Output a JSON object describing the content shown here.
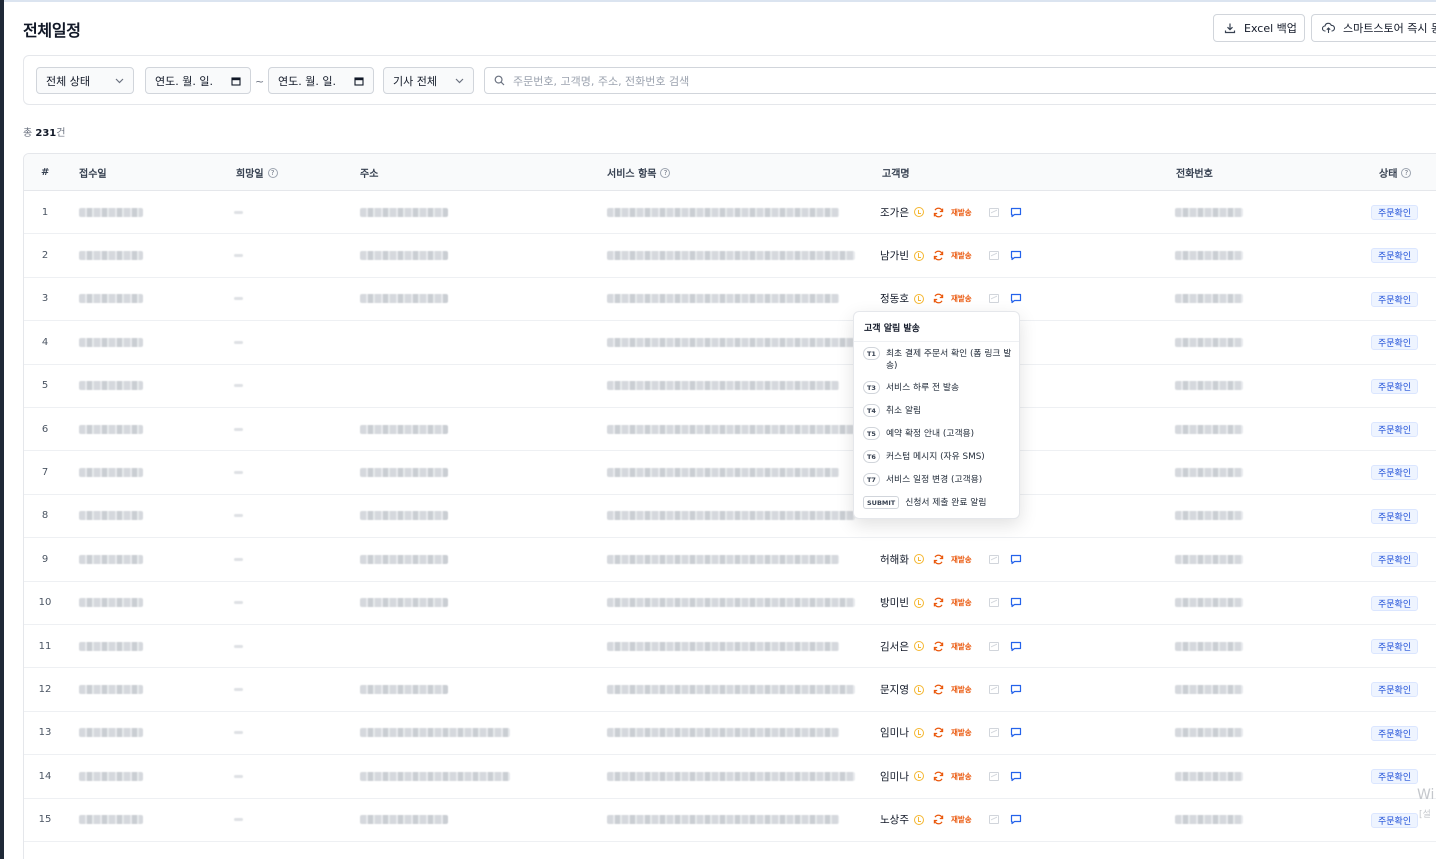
{
  "page": {
    "title": "전체일정"
  },
  "toolbar": {
    "excel_label": "Excel 백업",
    "store_label": "스마트스토어 즉시 동"
  },
  "filters": {
    "status": "전체 상태",
    "date_from": "연도. 월. 일.",
    "date_sep": "~",
    "date_to": "연도. 월. 일.",
    "driver": "기사 전체",
    "search_placeholder": "주문번호, 고객명, 주소, 전화번호 검색"
  },
  "summary": {
    "prefix": "총 ",
    "count": "231",
    "suffix": "건"
  },
  "table": {
    "headers": {
      "num": "#",
      "received": "접수일",
      "desired": "희망일",
      "address": "주소",
      "service": "서비스 항목",
      "customer": "고객명",
      "phone": "전화번호",
      "status": "상태"
    },
    "help_mark": "?",
    "resend_label": "재발송",
    "rows": [
      {
        "num": "1",
        "name": "조가은",
        "status": "주문확인",
        "has_address": true
      },
      {
        "num": "2",
        "name": "남가빈",
        "status": "주문확인",
        "has_address": true
      },
      {
        "num": "3",
        "name": "정동호",
        "status": "주문확인",
        "has_address": true
      },
      {
        "num": "4",
        "name": "",
        "status": "주문확인",
        "has_address": false
      },
      {
        "num": "5",
        "name": "",
        "status": "주문확인",
        "has_address": false
      },
      {
        "num": "6",
        "name": "",
        "status": "주문확인",
        "has_address": true
      },
      {
        "num": "7",
        "name": "",
        "status": "주문확인",
        "has_address": true
      },
      {
        "num": "8",
        "name": "",
        "status": "주문확인",
        "has_address": true
      },
      {
        "num": "9",
        "name": "허해화",
        "status": "주문확인",
        "has_address": true
      },
      {
        "num": "10",
        "name": "방미빈",
        "status": "주문확인",
        "has_address": true
      },
      {
        "num": "11",
        "name": "김서은",
        "status": "주문확인",
        "has_address": false
      },
      {
        "num": "12",
        "name": "문지영",
        "status": "주문확인",
        "has_address": true
      },
      {
        "num": "13",
        "name": "임미나",
        "status": "주문확인",
        "has_address": true
      },
      {
        "num": "14",
        "name": "임미나",
        "status": "주문확인",
        "has_address": true
      },
      {
        "num": "15",
        "name": "노상주",
        "status": "주문확인",
        "has_address": true
      }
    ]
  },
  "notification_popup": {
    "title": "고객 알림 발송",
    "items": [
      {
        "code": "T1",
        "label": "최초 결제 주문서 확인 (폼 링크 발송)"
      },
      {
        "code": "T3",
        "label": "서비스 하루 전 발송"
      },
      {
        "code": "T4",
        "label": "취소 알림"
      },
      {
        "code": "T5",
        "label": "예약 확정 안내 (고객용)"
      },
      {
        "code": "T6",
        "label": "커스텀 메시지 (자유 SMS)"
      },
      {
        "code": "T7",
        "label": "서비스 일정 변경 (고객용)"
      },
      {
        "code": "SUBMIT",
        "label": "신청서 제출 완료 알림"
      }
    ]
  },
  "colors": {
    "accent": "#1d4ed8",
    "resend": "#ea580c",
    "pending": "#f5b731",
    "badge_bg": "#eef4ff"
  },
  "watermark": {
    "line1": "Wi",
    "line2": "[설"
  }
}
